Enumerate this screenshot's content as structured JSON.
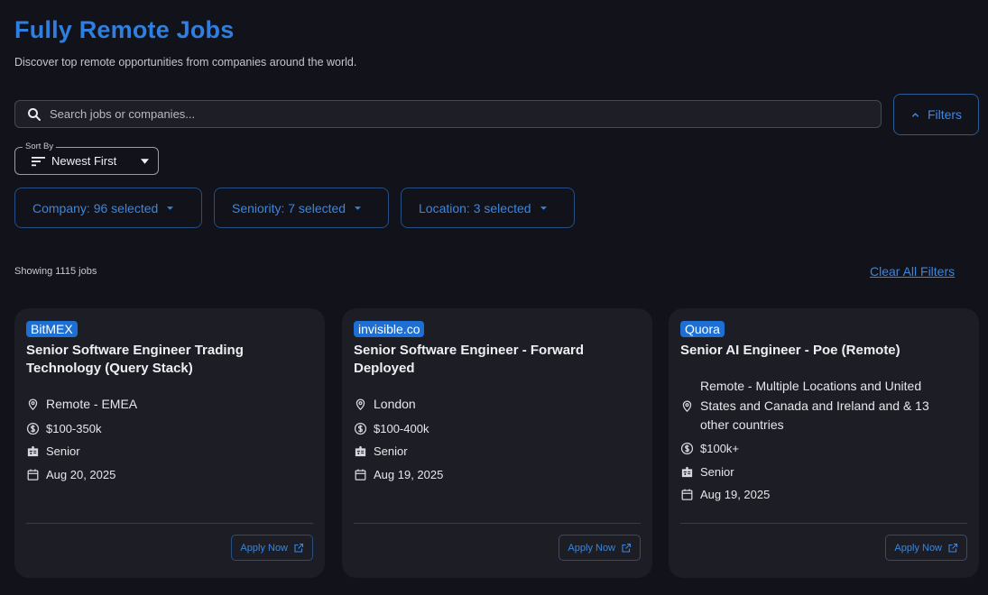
{
  "header": {
    "title": "Fully Remote Jobs",
    "subtitle": "Discover top remote opportunities from companies around the world."
  },
  "search": {
    "placeholder": "Search jobs or companies...",
    "value": ""
  },
  "filters_button": {
    "label": "Filters"
  },
  "sort": {
    "label": "Sort By",
    "value": "Newest First"
  },
  "filter_chips": [
    {
      "label": "Company: 96 selected"
    },
    {
      "label": "Seniority: 7 selected"
    },
    {
      "label": "Location: 3 selected"
    }
  ],
  "results": {
    "count_text": "Showing 1115 jobs",
    "clear_label": "Clear All Filters"
  },
  "colors": {
    "accent": "#2f7fe0",
    "badge": "#1e6fd4",
    "background": "#11121a",
    "card": "#1d1e25"
  },
  "jobs": [
    {
      "company": "BitMEX",
      "title": "Senior Software Engineer Trading Technology (Query Stack)",
      "location": "Remote - EMEA",
      "salary": "$100-350k",
      "seniority": "Senior",
      "date": "Aug 20, 2025",
      "apply_label": "Apply Now"
    },
    {
      "company": "invisible.co",
      "title": "Senior Software Engineer - Forward Deployed",
      "location": "London",
      "salary": "$100-400k",
      "seniority": "Senior",
      "date": "Aug 19, 2025",
      "apply_label": "Apply Now"
    },
    {
      "company": "Quora",
      "title": "Senior AI Engineer - Poe (Remote)",
      "location": "Remote - Multiple Locations and United States and Canada and Ireland and & 13 other countries",
      "salary": "$100k+",
      "seniority": "Senior",
      "date": "Aug 19, 2025",
      "apply_label": "Apply Now"
    }
  ]
}
